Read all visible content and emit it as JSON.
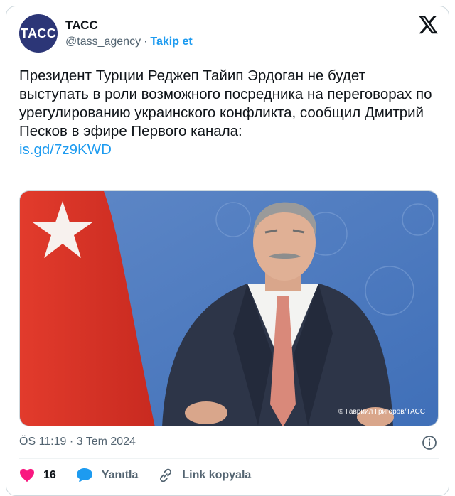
{
  "author": {
    "avatar_text": "ТАСС",
    "name": "ТАСС",
    "handle": "@tass_agency",
    "separator": "·",
    "follow_label": "Takip et"
  },
  "tweet": {
    "text": "Президент Турции Реджеп Тайип Эрдоган не будет выступать в роли возможного посредника на переговорах по урегулированию украинского конфликта, сообщил Дмитрий Песков в эфире Первого канала:",
    "link": "is.gd/7z9KWD",
    "image_credit": "© Гавриил Григоров/ТАСС",
    "timestamp": "ÖS 11:19 · 3 Tem 2024"
  },
  "actions": {
    "like_count": "16",
    "reply_label": "Yanıtla",
    "copy_link_label": "Link kopyala"
  },
  "colors": {
    "accent": "#1d9bf0",
    "like": "#f91880",
    "avatar_bg": "#2c3677",
    "muted": "#536471"
  },
  "icons": [
    "x-logo-icon",
    "info-icon",
    "heart-icon",
    "reply-bubble-icon",
    "link-icon"
  ]
}
